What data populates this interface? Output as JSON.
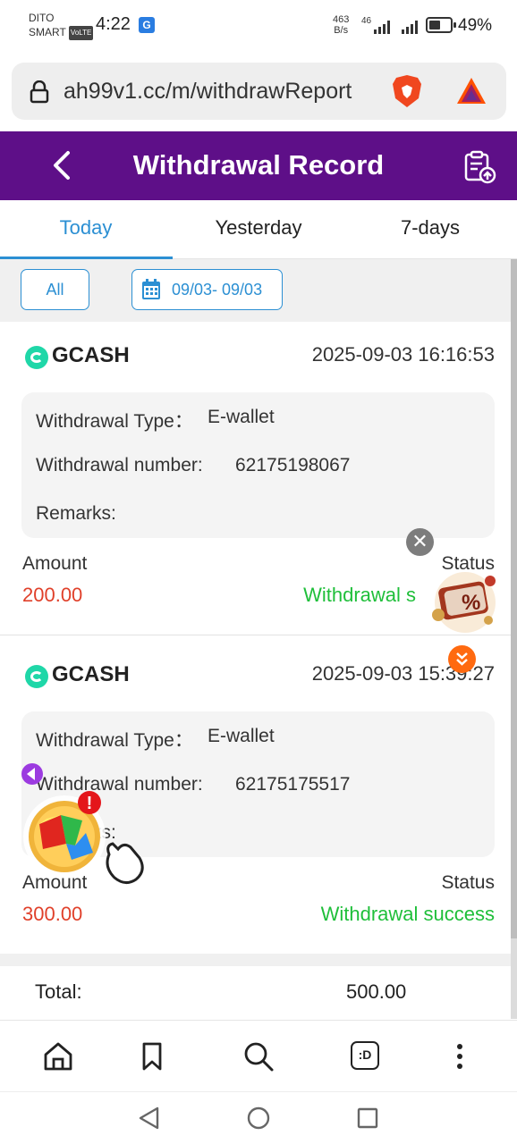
{
  "status_bar": {
    "carrier_line1": "DITO",
    "carrier_line2": "SMART",
    "volte": "VoLTE",
    "time": "4:22",
    "notification_badge": "G",
    "net_speed_value": "463",
    "net_speed_unit": "B/s",
    "network_type": "46",
    "battery_percent": "49%"
  },
  "browser": {
    "url": "ah99v1.cc/m/withdrawReport"
  },
  "header": {
    "title": "Withdrawal Record"
  },
  "tabs": [
    {
      "label": "Today",
      "active": true
    },
    {
      "label": "Yesterday",
      "active": false
    },
    {
      "label": "7-days",
      "active": false
    }
  ],
  "filter": {
    "all_label": "All",
    "date_range": "09/03- 09/03"
  },
  "records": [
    {
      "provider": "GCASH",
      "datetime": "2025-09-03 16:16:53",
      "type_label": "Withdrawal Type：",
      "type_value": "E-wallet",
      "number_label": "Withdrawal number:",
      "number_value": "62175198067",
      "remarks_label": "Remarks:",
      "amount_label": "Amount",
      "amount_value": "200.00",
      "status_label": "Status",
      "status_value": "Withdrawal s"
    },
    {
      "provider": "GCASH",
      "datetime": "2025-09-03 15:39:27",
      "type_label": "Withdrawal Type：",
      "type_value": "E-wallet",
      "number_label": "Withdrawal number:",
      "number_value": "62175175517",
      "remarks_label": "Remarks:",
      "amount_label": "Amount",
      "amount_value": "300.00",
      "status_label": "Status",
      "status_value": "Withdrawal success"
    }
  ],
  "total": {
    "label": "Total:",
    "value": "500.00"
  },
  "overlay": {
    "close_glyph": "✕",
    "promo_glyph": "%",
    "alert_glyph": "!"
  },
  "browser_bar": {
    "tabs_icon_text": ":D"
  },
  "colors": {
    "header_bg": "#5e0f88",
    "accent_blue": "#2b8fd3",
    "amount_red": "#e0402a",
    "success_green": "#1fbf3a"
  }
}
